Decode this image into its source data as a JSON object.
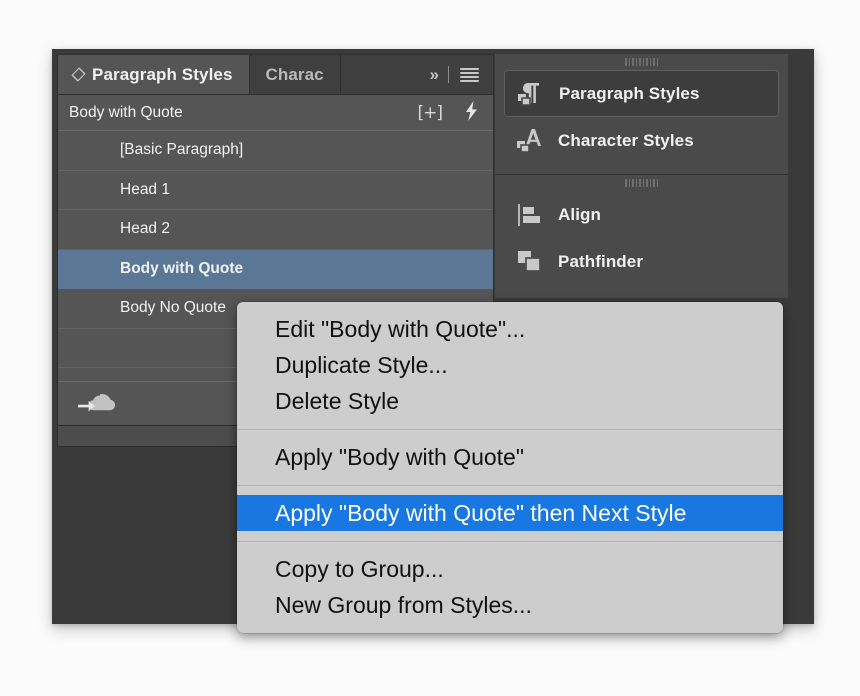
{
  "app": {
    "panel_title": "Paragraph Styles"
  },
  "styles_panel": {
    "tabs": [
      {
        "label": "Paragraph Styles",
        "active": true,
        "icon": "diamond-icon"
      },
      {
        "label": "Charac",
        "active": false
      }
    ],
    "tabbar_controls": [
      {
        "name": "expand-panels-icon",
        "glyph": "»"
      },
      {
        "name": "panel-menu-icon",
        "glyph": "≡"
      }
    ],
    "current_style": "Body with Quote",
    "header_icons": [
      {
        "name": "new-style-icon",
        "glyph": "[+]"
      },
      {
        "name": "clear-overrides-icon",
        "glyph": "⚡"
      }
    ],
    "list": [
      {
        "label": "[Basic Paragraph]",
        "selected": false
      },
      {
        "label": "Head 1",
        "selected": false
      },
      {
        "label": "Head 2",
        "selected": false
      },
      {
        "label": "Body with Quote",
        "selected": true
      },
      {
        "label": "Body No Quote",
        "selected": false
      },
      {
        "label": "",
        "selected": false
      }
    ],
    "footer_icon": "cloud-upload-icon",
    "selection_color": "#5b7796",
    "panel_bg": "#555555"
  },
  "dock": {
    "groups": [
      {
        "grip": "panel-grip",
        "items": [
          {
            "label": "Paragraph Styles",
            "icon": "paragraph-styles-icon",
            "active": true
          },
          {
            "label": "Character Styles",
            "icon": "character-styles-icon",
            "active": false
          }
        ]
      },
      {
        "grip": "panel-grip",
        "items": [
          {
            "label": "Align",
            "icon": "align-icon",
            "active": false
          },
          {
            "label": "Pathfinder",
            "icon": "pathfinder-icon",
            "active": false
          }
        ]
      }
    ],
    "active_color": "#3d3d3d"
  },
  "context_menu": {
    "highlight_color": "#1877e0",
    "background": "#cdcdcd",
    "groups": [
      {
        "items": [
          {
            "label": "Edit \"Body with Quote\"...",
            "highlighted": false
          },
          {
            "label": "Duplicate Style...",
            "highlighted": false
          },
          {
            "label": "Delete Style",
            "highlighted": false
          }
        ]
      },
      {
        "items": [
          {
            "label": "Apply \"Body with Quote\"",
            "highlighted": false
          }
        ]
      },
      {
        "items": [
          {
            "label": "Apply \"Body with Quote\" then Next Style",
            "highlighted": true
          }
        ]
      },
      {
        "items": [
          {
            "label": "Copy to Group...",
            "highlighted": false
          },
          {
            "label": "New Group from Styles...",
            "highlighted": false
          }
        ]
      }
    ]
  }
}
